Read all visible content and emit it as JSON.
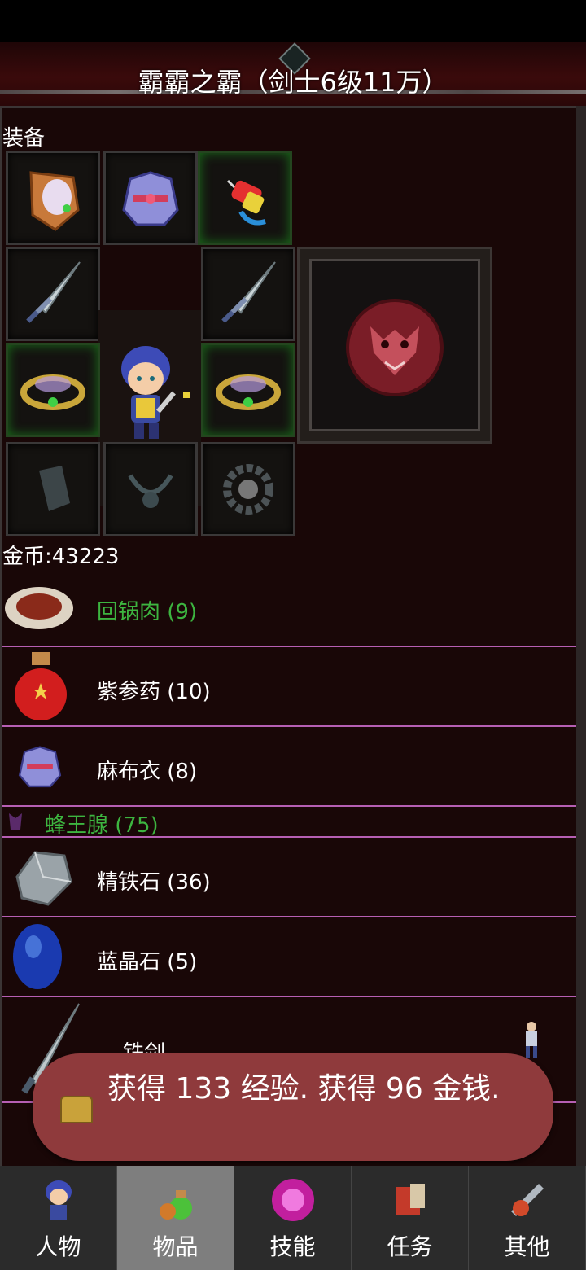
{
  "title": "霸霸之霸（剑士6级11万）",
  "equipment": {
    "label": "装备",
    "slots": [
      {
        "name": "armor-piece",
        "icon": "shoulder-armor-icon"
      },
      {
        "name": "cloth-robe",
        "icon": "robe-icon"
      },
      {
        "name": "firecracker",
        "icon": "firecracker-icon"
      },
      {
        "name": "left-sword",
        "icon": "sword-icon"
      },
      {
        "name": "right-sword",
        "icon": "sword-icon"
      },
      {
        "name": "left-ring",
        "icon": "ring-icon"
      },
      {
        "name": "right-ring",
        "icon": "ring-icon"
      },
      {
        "name": "empty-bracer",
        "icon": "bracer-icon"
      },
      {
        "name": "empty-necklace",
        "icon": "necklace-icon"
      },
      {
        "name": "empty-beads",
        "icon": "beads-icon"
      }
    ],
    "special_icon": "tiger-emblem-icon"
  },
  "gold": "金币:43223",
  "inventory": [
    {
      "label": "回锅肉 (9)",
      "color": "#3db540",
      "icon": "meat-plate-icon"
    },
    {
      "label": "紫参药 (10)",
      "color": "#ffffff",
      "icon": "potion-icon"
    },
    {
      "label": "麻布衣 (8)",
      "color": "#ffffff",
      "icon": "robe-icon"
    },
    {
      "label": "蜂王腺 (75)",
      "color": "#3db540",
      "icon": "bee-gland-icon"
    },
    {
      "label": "精铁石 (36)",
      "color": "#ffffff",
      "icon": "iron-ore-icon"
    },
    {
      "label": "蓝晶石 (5)",
      "color": "#ffffff",
      "icon": "blue-crystal-icon"
    },
    {
      "label": "铁剑",
      "color": "#ffffff",
      "icon": "sword-icon"
    }
  ],
  "toast": {
    "text": "获得 133 经验. 获得 96 金钱."
  },
  "tabs": [
    {
      "label": "人物",
      "icon": "hero-icon"
    },
    {
      "label": "物品",
      "icon": "potion-bag-icon"
    },
    {
      "label": "技能",
      "icon": "skill-orb-icon"
    },
    {
      "label": "任务",
      "icon": "quest-book-icon"
    },
    {
      "label": "其他",
      "icon": "other-icon"
    }
  ],
  "active_tab": "物品"
}
